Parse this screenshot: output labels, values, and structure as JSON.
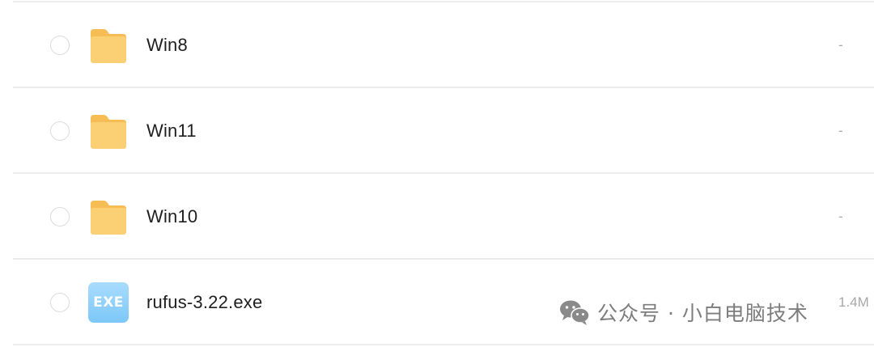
{
  "files": [
    {
      "name": "Win8",
      "size": "-",
      "type": "folder",
      "icon": "folder-icon"
    },
    {
      "name": "Win11",
      "size": "-",
      "type": "folder",
      "icon": "folder-icon"
    },
    {
      "name": "Win10",
      "size": "-",
      "type": "folder",
      "icon": "folder-icon"
    },
    {
      "name": "rufus-3.22.exe",
      "size": "1.4M",
      "type": "exe",
      "icon": "exe-file-icon",
      "icon_label": "EXE"
    }
  ],
  "watermark": {
    "text": "公众号 · 小白电脑技术",
    "icon": "wechat-icon"
  },
  "colors": {
    "folder": "#f9c96a",
    "exe_tile": "#8fd0fb",
    "divider": "#ececec"
  }
}
